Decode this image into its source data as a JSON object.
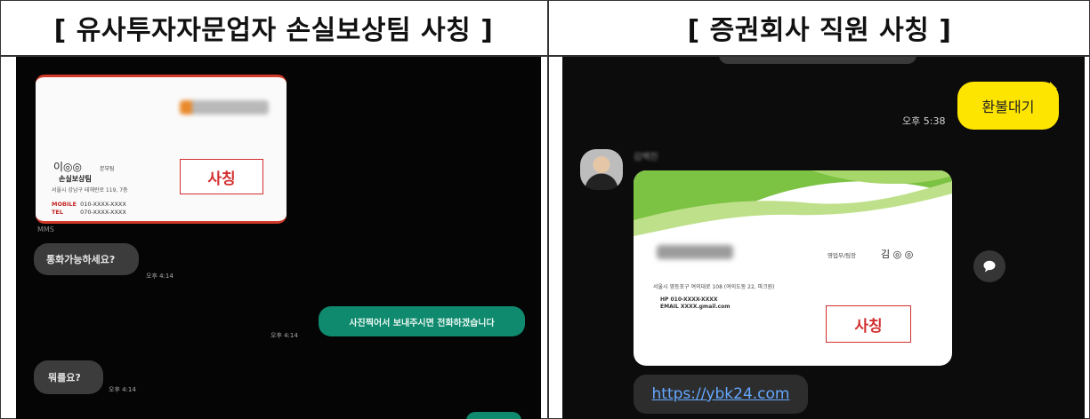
{
  "headers": {
    "left": "[ 유사투자자문업자 손실보상팀 사칭 ]",
    "right": "[ 증권회사 직원 사칭 ]"
  },
  "left_panel": {
    "card": {
      "name": "이◎◎",
      "position": "본부팀",
      "team": "손실보상팀",
      "address": "서울시 강남구 테헤란로 119, 7층",
      "mobile_label": "MOBILE",
      "mobile": "010-XXXX-XXXX",
      "tel_label": "TEL",
      "tel": "070-XXXX-XXXX",
      "stamp": "사칭"
    },
    "mms_label": "MMS",
    "messages": [
      {
        "text": "통화가능하세요?",
        "time": "오후 4:14",
        "side": "left"
      },
      {
        "text": "사진찍어서 보내주시면 전화하겠습니다",
        "time": "오후 4:14",
        "side": "right"
      },
      {
        "text": "뭐를요?",
        "time": "오후 4:14",
        "side": "left"
      }
    ]
  },
  "right_panel": {
    "yellow_message": "환불대기",
    "time": "오후 5:38",
    "card": {
      "position": "영업부/팀장",
      "name": "김 ◎ ◎",
      "address": "서울시 영등포구 여의대로 108 (여의도동 22, 파크원)",
      "hp": "HP 010-XXXX-XXXX",
      "email": "EMAIL  XXXX.gmail.com",
      "stamp": "사칭"
    },
    "link": "https://ybk24.com"
  },
  "colors": {
    "stamp_red": "#d32f2f",
    "kakao_yellow": "#fee500",
    "message_green": "#0f8a6e",
    "link_blue": "#64a8ff"
  }
}
